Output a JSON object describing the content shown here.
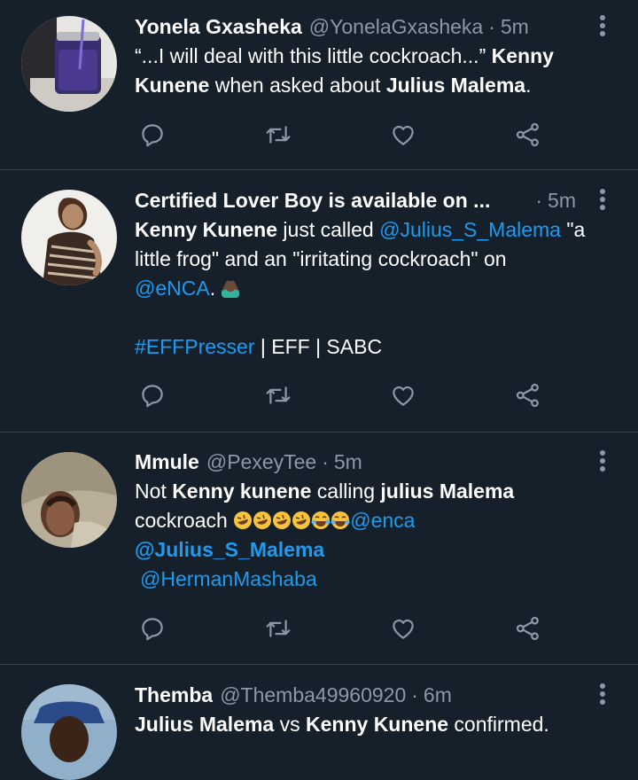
{
  "tweets": [
    {
      "name": "Yonela Gxasheka",
      "handle": "@YonelaGxasheka",
      "dot": "·",
      "time": "5m",
      "line1_a": "“...I will deal with this little cockroach...” ",
      "line1_b": "Kenny",
      "line2_a": "Kunene",
      "line2_b": " when asked about ",
      "line2_c": "Julius Malema",
      "line2_d": "."
    },
    {
      "name": "Certified Lover Boy is available on ...",
      "dot": "·",
      "time": "5m",
      "line1_a": "Kenny Kunene",
      "line1_b": " just called ",
      "line1_c": "@Julius_S_Malema",
      "line1_d": " \"a",
      "line2": "little frog\" and an \"irritating cockroach\" on",
      "line3_a": "@eNCA",
      "line3_b": ". ",
      "line4_a": "#EFFPresser",
      "line4_b": " | EFF | SABC",
      "emoji_icon": "person-facepalming-emoji"
    },
    {
      "name": "Mmule",
      "handle": "@PexeyTee",
      "dot": "·",
      "time": "5m",
      "line1_a": "Not ",
      "line1_b": "Kenny kunene",
      "line1_c": " calling ",
      "line1_d": "julius Malema",
      "line2_a": "cockroach ",
      "line2_b": "@enca",
      "line3": "@Julius_S_Malema",
      "line4": "@HermanMashaba",
      "emoji_icons": [
        "rolling-on-floor-laughing-emoji",
        "rolling-on-floor-laughing-emoji",
        "rolling-on-floor-laughing-emoji",
        "rolling-on-floor-laughing-emoji",
        "tears-of-joy-emoji",
        "tears-of-joy-emoji"
      ]
    },
    {
      "name": "Themba",
      "handle": "@Themba49960920",
      "dot": "·",
      "time": "6m",
      "line1_a": "Julius Malema",
      "line1_b": " vs ",
      "line1_c": "Kenny Kunene",
      "line1_d": " confirmed."
    }
  ],
  "colors": {
    "background": "#15202b",
    "divider": "#38444d",
    "text": "#ffffff",
    "muted": "#8b98a5",
    "link": "#1d9bf0"
  },
  "icons": [
    "reply-icon",
    "retweet-icon",
    "like-icon",
    "share-icon",
    "more-options-icon"
  ]
}
